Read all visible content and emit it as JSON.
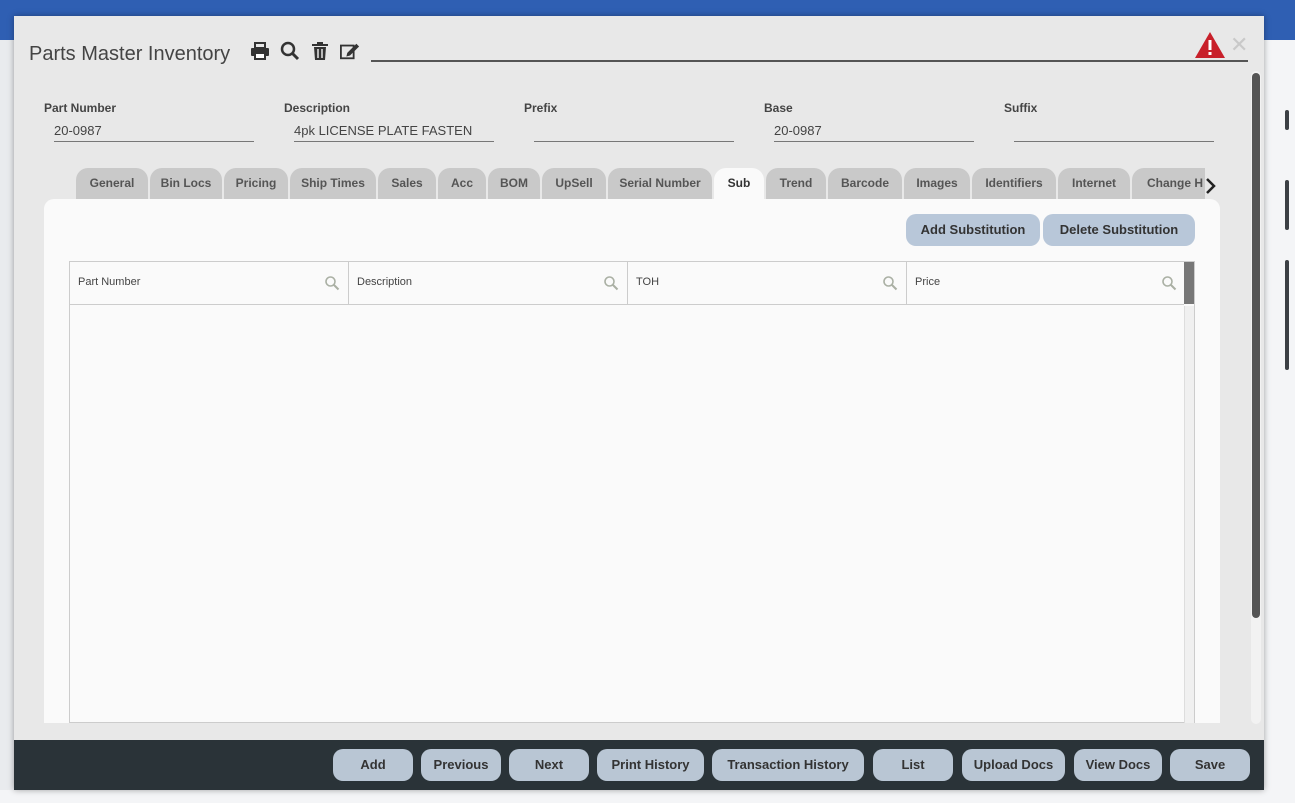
{
  "dialog": {
    "title": "Parts Master Inventory",
    "icons": [
      "print-icon",
      "search-icon",
      "trash-icon",
      "edit-icon"
    ],
    "warning_icon": "warning-icon",
    "close_symbol": "✕"
  },
  "fields": [
    {
      "label": "Part Number",
      "value": "20-0987"
    },
    {
      "label": "Description",
      "value": "4pk LICENSE PLATE FASTEN"
    },
    {
      "label": "Prefix",
      "value": ""
    },
    {
      "label": "Base",
      "value": "20-0987"
    },
    {
      "label": "Suffix",
      "value": ""
    }
  ],
  "tabs": [
    {
      "label": "General"
    },
    {
      "label": "Bin Locs"
    },
    {
      "label": "Pricing"
    },
    {
      "label": "Ship Times"
    },
    {
      "label": "Sales"
    },
    {
      "label": "Acc"
    },
    {
      "label": "BOM"
    },
    {
      "label": "UpSell"
    },
    {
      "label": "Serial Number"
    },
    {
      "label": "Sub",
      "active": true
    },
    {
      "label": "Trend"
    },
    {
      "label": "Barcode"
    },
    {
      "label": "Images"
    },
    {
      "label": "Identifiers"
    },
    {
      "label": "Internet"
    },
    {
      "label": "Change H"
    }
  ],
  "sub_panel": {
    "add_label": "Add Substitution",
    "delete_label": "Delete Substitution",
    "columns": [
      "Part Number",
      "Description",
      "TOH",
      "Price"
    ],
    "rows": []
  },
  "footer": {
    "buttons": [
      "Add",
      "Previous",
      "Next",
      "Print History",
      "Transaction History",
      "List",
      "Upload Docs",
      "View Docs",
      "Save"
    ]
  },
  "colors": {
    "topbar": "#2f5fb3",
    "footer": "#2a3338",
    "button": "#b9c6d4",
    "warning": "#c8202a"
  }
}
